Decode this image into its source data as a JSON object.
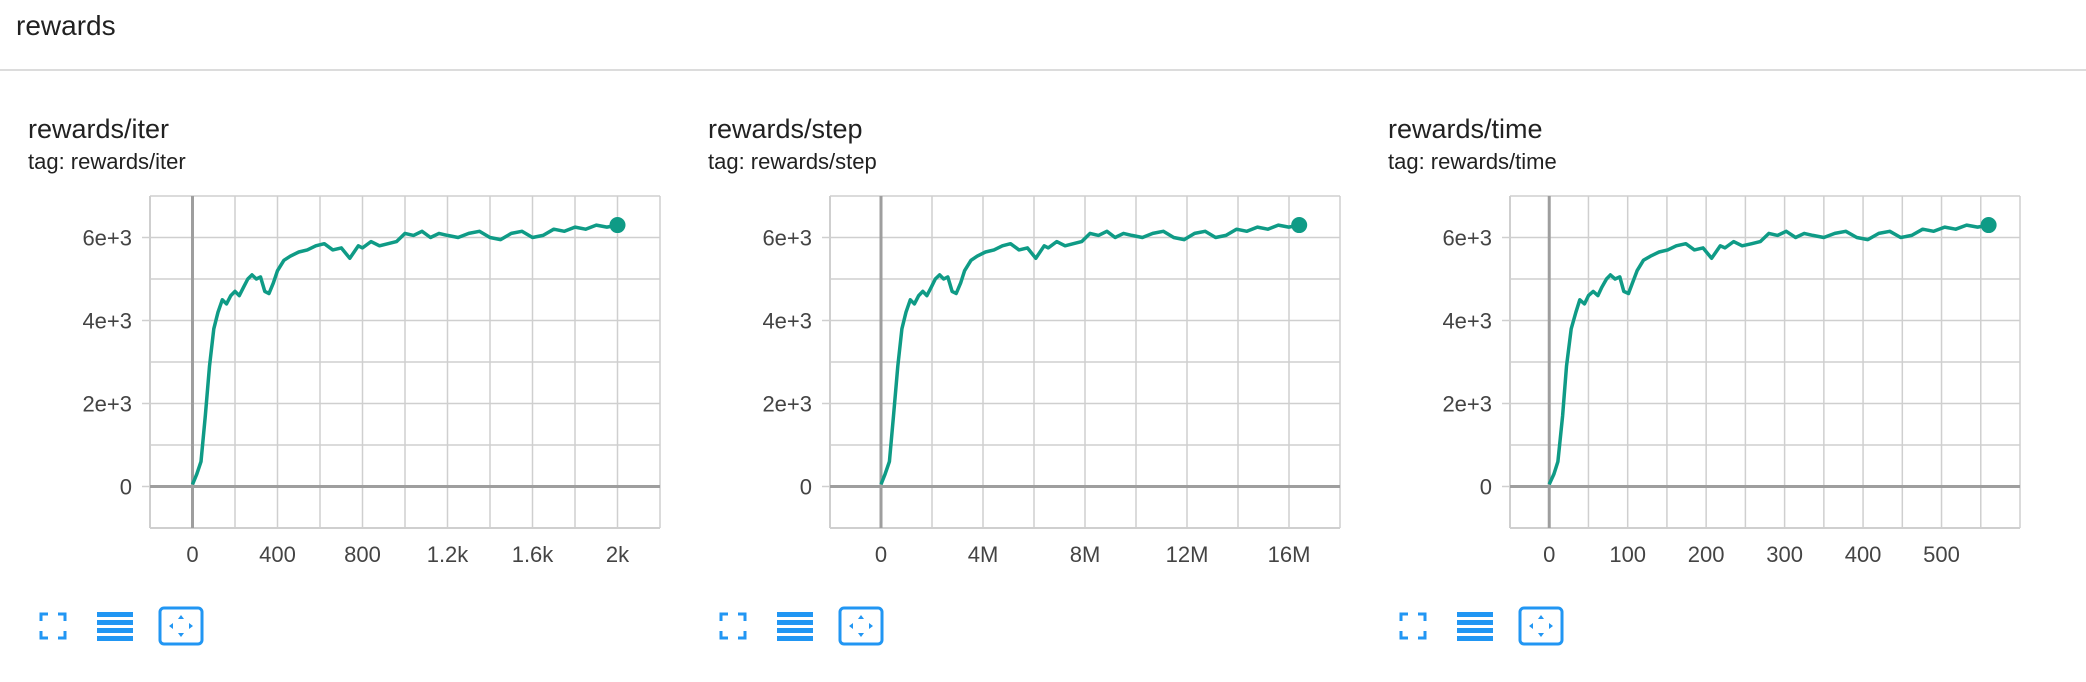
{
  "section": {
    "title": "rewards"
  },
  "colors": {
    "line": "#0f9b86",
    "grid": "#cfcfcf",
    "axis": "#9e9e9e",
    "icon": "#2196f3",
    "text": "#212121",
    "tick": "#444444"
  },
  "icons": {
    "fullscreen": "fullscreen-icon",
    "data_table": "data-table-icon",
    "fit_domain": "fit-to-domain-icon"
  },
  "charts": [
    {
      "title": "rewards/iter",
      "tag": "tag: rewards/iter",
      "x_ticks": [
        "0",
        "400",
        "800",
        "1.2k",
        "1.6k",
        "2k"
      ],
      "y_ticks": [
        "0",
        "2e+3",
        "4e+3",
        "6e+3"
      ]
    },
    {
      "title": "rewards/step",
      "tag": "tag: rewards/step",
      "x_ticks": [
        "0",
        "4M",
        "8M",
        "12M",
        "16M"
      ],
      "y_ticks": [
        "0",
        "2e+3",
        "4e+3",
        "6e+3"
      ]
    },
    {
      "title": "rewards/time",
      "tag": "tag: rewards/time",
      "x_ticks": [
        "0",
        "100",
        "200",
        "300",
        "400",
        "500"
      ],
      "y_ticks": [
        "0",
        "2e+3",
        "4e+3",
        "6e+3"
      ]
    }
  ],
  "chart_data": [
    {
      "type": "line",
      "title": "rewards/iter",
      "xlabel": "",
      "ylabel": "",
      "xlim": [
        -200,
        2200
      ],
      "ylim": [
        -1000,
        7000
      ],
      "x_tick_values": [
        0,
        400,
        800,
        1200,
        1600,
        2000
      ],
      "y_tick_values": [
        0,
        2000,
        4000,
        6000
      ],
      "grid": true,
      "series": [
        {
          "x": [
            0,
            20,
            40,
            60,
            80,
            100,
            120,
            140,
            160,
            180,
            200,
            220,
            240,
            260,
            280,
            300,
            320,
            340,
            360,
            380,
            400,
            430,
            460,
            500,
            540,
            580,
            620,
            660,
            700,
            740,
            780,
            800,
            840,
            880,
            920,
            960,
            1000,
            1040,
            1080,
            1120,
            1160,
            1200,
            1250,
            1300,
            1350,
            1400,
            1450,
            1500,
            1550,
            1600,
            1650,
            1700,
            1750,
            1800,
            1850,
            1900,
            1950,
            2000
          ],
          "y": [
            50,
            300,
            600,
            1700,
            2900,
            3800,
            4200,
            4500,
            4400,
            4600,
            4700,
            4600,
            4800,
            5000,
            5100,
            5000,
            5050,
            4700,
            4650,
            4900,
            5200,
            5450,
            5550,
            5650,
            5700,
            5800,
            5850,
            5700,
            5750,
            5500,
            5800,
            5750,
            5900,
            5800,
            5850,
            5900,
            6100,
            6050,
            6150,
            6000,
            6100,
            6050,
            6000,
            6100,
            6150,
            6000,
            5950,
            6100,
            6150,
            6000,
            6050,
            6200,
            6150,
            6250,
            6200,
            6300,
            6250,
            6300
          ]
        }
      ]
    },
    {
      "type": "line",
      "title": "rewards/step",
      "xlabel": "",
      "ylabel": "",
      "xlim": [
        -2000000,
        18000000
      ],
      "ylim": [
        -1000,
        7000
      ],
      "x_tick_values": [
        0,
        4000000,
        8000000,
        12000000,
        16000000
      ],
      "y_tick_values": [
        0,
        2000,
        4000,
        6000
      ],
      "grid": true,
      "series": [
        {
          "x": [
            0,
            160000,
            330000,
            490000,
            660000,
            820000,
            980000,
            1150000,
            1310000,
            1480000,
            1640000,
            1800000,
            1970000,
            2130000,
            2300000,
            2460000,
            2620000,
            2790000,
            2950000,
            3120000,
            3280000,
            3530000,
            3770000,
            4100000,
            4430000,
            4760000,
            5080000,
            5410000,
            5740000,
            6070000,
            6400000,
            6560000,
            6890000,
            7220000,
            7540000,
            7870000,
            8200000,
            8530000,
            8860000,
            9180000,
            9510000,
            9840000,
            10250000,
            10660000,
            11070000,
            11480000,
            11890000,
            12300000,
            12710000,
            13120000,
            13530000,
            13940000,
            14350000,
            14760000,
            15170000,
            15580000,
            15990000,
            16400000
          ],
          "y": [
            50,
            300,
            600,
            1700,
            2900,
            3800,
            4200,
            4500,
            4400,
            4600,
            4700,
            4600,
            4800,
            5000,
            5100,
            5000,
            5050,
            4700,
            4650,
            4900,
            5200,
            5450,
            5550,
            5650,
            5700,
            5800,
            5850,
            5700,
            5750,
            5500,
            5800,
            5750,
            5900,
            5800,
            5850,
            5900,
            6100,
            6050,
            6150,
            6000,
            6100,
            6050,
            6000,
            6100,
            6150,
            6000,
            5950,
            6100,
            6150,
            6000,
            6050,
            6200,
            6150,
            6250,
            6200,
            6300,
            6250,
            6300
          ]
        }
      ]
    },
    {
      "type": "line",
      "title": "rewards/time",
      "xlabel": "",
      "ylabel": "",
      "xlim": [
        -50,
        600
      ],
      "ylim": [
        -1000,
        7000
      ],
      "x_tick_values": [
        0,
        100,
        200,
        300,
        400,
        500
      ],
      "y_tick_values": [
        0,
        2000,
        4000,
        6000
      ],
      "grid": true,
      "series": [
        {
          "x": [
            0,
            6,
            11,
            17,
            22,
            28,
            34,
            39,
            45,
            50,
            56,
            62,
            67,
            73,
            78,
            84,
            90,
            95,
            101,
            106,
            112,
            120,
            129,
            140,
            151,
            162,
            174,
            185,
            196,
            207,
            218,
            224,
            235,
            246,
            258,
            269,
            280,
            291,
            302,
            314,
            325,
            336,
            350,
            364,
            378,
            392,
            406,
            420,
            434,
            448,
            462,
            476,
            490,
            504,
            518,
            532,
            546,
            560
          ],
          "y": [
            50,
            300,
            600,
            1700,
            2900,
            3800,
            4200,
            4500,
            4400,
            4600,
            4700,
            4600,
            4800,
            5000,
            5100,
            5000,
            5050,
            4700,
            4650,
            4900,
            5200,
            5450,
            5550,
            5650,
            5700,
            5800,
            5850,
            5700,
            5750,
            5500,
            5800,
            5750,
            5900,
            5800,
            5850,
            5900,
            6100,
            6050,
            6150,
            6000,
            6100,
            6050,
            6000,
            6100,
            6150,
            6000,
            5950,
            6100,
            6150,
            6000,
            6050,
            6200,
            6150,
            6250,
            6200,
            6300,
            6250,
            6300
          ]
        }
      ]
    }
  ]
}
